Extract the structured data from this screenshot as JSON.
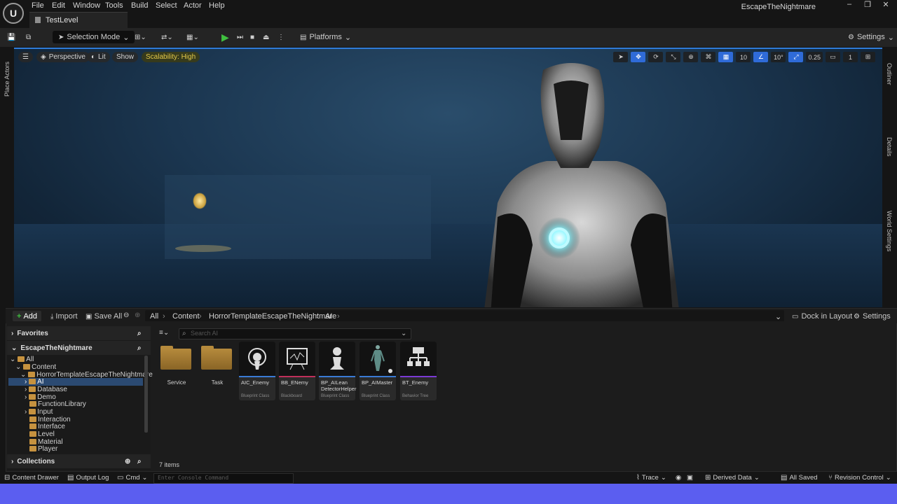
{
  "menu": {
    "logo": "U",
    "items": [
      "File",
      "Edit",
      "Window",
      "Tools",
      "Build",
      "Select",
      "Actor",
      "Help"
    ],
    "level_tab": "TestLevel",
    "project_name": "EscapeTheNightmare",
    "window_buttons": [
      "–",
      "❐",
      "✕"
    ]
  },
  "toolbar": {
    "selection_mode": "Selection Mode",
    "platforms": "Platforms",
    "settings": "Settings"
  },
  "viewport": {
    "perspective": "Perspective",
    "lit": "Lit",
    "show": "Show",
    "scalability": "Scalability: High",
    "grid_snap": "10",
    "rotation_snap": "10°",
    "scale_snap": "0.25",
    "camera_speed": "1"
  },
  "side_panels": {
    "left": "Place Actors",
    "right_outliner": "Outliner",
    "right_details": "Details",
    "right_world": "World Settings"
  },
  "content_browser": {
    "add": "Add",
    "import": "Import",
    "save_all": "Save All",
    "breadcrumb": [
      "All",
      "Content",
      "HorrorTemplateEscapeTheNightmare",
      "AI"
    ],
    "dock_in_layout": "Dock in Layout",
    "settings": "Settings",
    "favorites": "Favorites",
    "project": "EscapeTheNightmare",
    "collections": "Collections",
    "search_placeholder": "Search AI",
    "items_count": "7 items",
    "tree": [
      {
        "label": "All",
        "level": 0
      },
      {
        "label": "Content",
        "level": 1
      },
      {
        "label": "HorrorTemplateEscapeTheNightmare",
        "level": 2
      },
      {
        "label": "AI",
        "level": 3
      },
      {
        "label": "Database",
        "level": 3
      },
      {
        "label": "Demo",
        "level": 3
      },
      {
        "label": "FunctionLibrary",
        "level": 3
      },
      {
        "label": "Input",
        "level": 3
      },
      {
        "label": "Interaction",
        "level": 3
      },
      {
        "label": "Interface",
        "level": 3
      },
      {
        "label": "Level",
        "level": 3
      },
      {
        "label": "Material",
        "level": 3
      },
      {
        "label": "Player",
        "level": 3
      }
    ],
    "folders": [
      "Service",
      "Task"
    ],
    "assets": [
      {
        "name": "AIC_Enemy",
        "type": "Blueprint Class",
        "color": "#3a7bd5"
      },
      {
        "name": "BB_ENemy",
        "type": "Blackboard",
        "color": "#c0305a"
      },
      {
        "name": "BP_AILean DetectorHelper",
        "type": "Blueprint Class",
        "color": "#3a7bd5"
      },
      {
        "name": "BP_AIMaster",
        "type": "Blueprint Class",
        "color": "#3a7bd5"
      },
      {
        "name": "BT_Enemy",
        "type": "Behavior Tree",
        "color": "#7b3ad5"
      }
    ]
  },
  "statusbar": {
    "content_drawer": "Content Drawer",
    "output_log": "Output Log",
    "cmd": "Cmd",
    "console_placeholder": "Enter Console Command",
    "trace": "Trace",
    "derived_data": "Derived Data",
    "all_saved": "All Saved",
    "revision_control": "Revision Control"
  }
}
